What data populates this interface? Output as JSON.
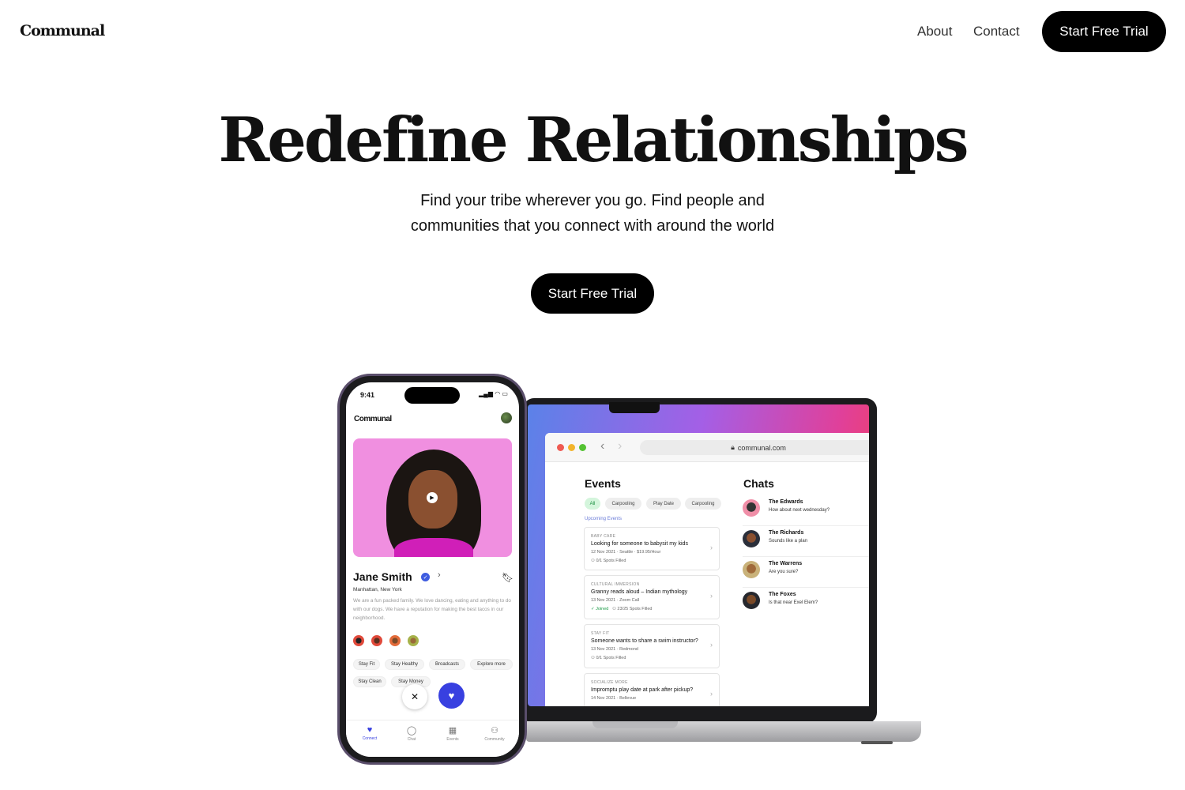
{
  "header": {
    "logo": "Communal",
    "nav": {
      "about": "About",
      "contact": "Contact"
    },
    "cta": "Start Free Trial"
  },
  "hero": {
    "title": "Redefine Relationships",
    "subtitle_line1": "Find your tribe wherever you go. Find people and",
    "subtitle_line2": "communities that you connect with around the world",
    "cta": "Start Free Trial"
  },
  "laptop": {
    "url": "communal.com",
    "events": {
      "title": "Events",
      "filters": [
        "All",
        "Carpooling",
        "Play Date",
        "Carpooling"
      ],
      "upcoming_label": "Upcoming Events",
      "items": [
        {
          "category": "BABY CARE",
          "name": "Looking for someone to babysit my kids",
          "date": "12 Nov 2021",
          "location": "Seattle",
          "price": "$19.95/Hour",
          "spots": "0/1 Spots Filled",
          "joined": ""
        },
        {
          "category": "CULTURAL IMMERSION",
          "name": "Granny reads aloud – Indian mythology",
          "date": "13 Nov 2021",
          "location": "Zoom Call",
          "price": "",
          "spots": "23/25 Spots Filled",
          "joined": "Joined"
        },
        {
          "category": "STAY FIT",
          "name": "Someone wants to share a swim instructor?",
          "date": "13 Nov 2021",
          "location": "Redmond",
          "price": "",
          "spots": "0/1 Spots Filled",
          "joined": ""
        },
        {
          "category": "SOCIALIZE MORE",
          "name": "Impromptu play date at park after pickup?",
          "date": "14 Nov 2021",
          "location": "Bellevue",
          "price": "",
          "spots": "",
          "joined": ""
        }
      ]
    },
    "chats": {
      "title": "Chats",
      "items": [
        {
          "name": "The Edwards",
          "message": "How about next wednesday?"
        },
        {
          "name": "The Richards",
          "message": "Sounds like a plan"
        },
        {
          "name": "The Warrens",
          "message": "Are you sure?"
        },
        {
          "name": "The Foxes",
          "message": "Is that near Exel Elem?"
        }
      ]
    }
  },
  "phone": {
    "time": "9:41",
    "logo": "Communal",
    "profile": {
      "name": "Jane Smith",
      "location": "Manhattan, New York",
      "bio": "We are a fun packed family. We love dancing, eating and anything to do with our dogs. We have a reputation for making the best tacos in our neighborhood."
    },
    "tags": [
      "Stay Fit",
      "Stay Healthy",
      "Broadcasts",
      "Explore more",
      "Stay Clean",
      "Stay Money"
    ],
    "tabs": [
      "Connect",
      "Chat",
      "Events",
      "Community"
    ]
  },
  "colors": {
    "accent": "#3840e0",
    "button": "#000000",
    "joined": "#1a9a46"
  }
}
